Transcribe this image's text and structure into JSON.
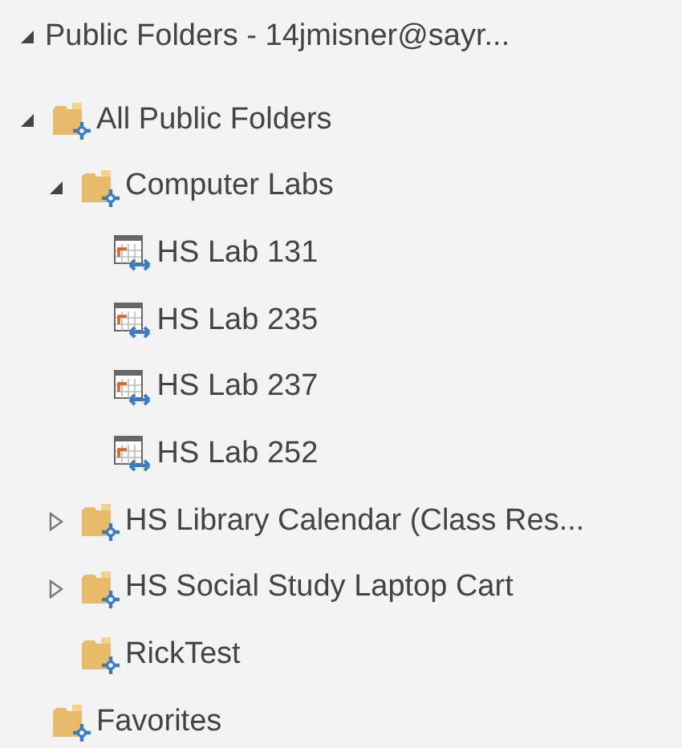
{
  "header": {
    "label": "Public Folders - 14jmisner@sayr...",
    "expanded": true
  },
  "tree": [
    {
      "label": "All Public Folders",
      "kind": "folder",
      "expanded": true,
      "children": [
        {
          "label": "Computer Labs",
          "kind": "folder",
          "expanded": true,
          "children": [
            {
              "label": "HS Lab 131",
              "kind": "calendar"
            },
            {
              "label": "HS Lab 235",
              "kind": "calendar"
            },
            {
              "label": "HS Lab 237",
              "kind": "calendar"
            },
            {
              "label": "HS Lab 252",
              "kind": "calendar"
            }
          ]
        },
        {
          "label": "HS Library Calendar (Class Res...",
          "kind": "folder",
          "expanded": false
        },
        {
          "label": "HS Social Study Laptop Cart",
          "kind": "folder",
          "expanded": false
        },
        {
          "label": "RickTest",
          "kind": "folder"
        }
      ]
    },
    {
      "label": "Favorites",
      "kind": "folder"
    }
  ]
}
